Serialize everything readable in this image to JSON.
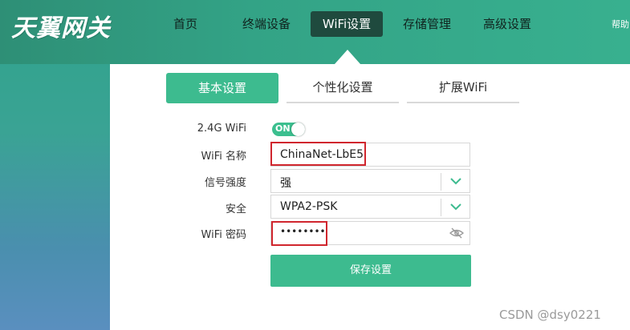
{
  "brand": {
    "logo_text": "天翼网关"
  },
  "nav": {
    "items": [
      {
        "label": "首页"
      },
      {
        "label": "终端设备"
      },
      {
        "label": "WiFi设置",
        "active": true
      },
      {
        "label": "存储管理"
      },
      {
        "label": "高级设置"
      }
    ],
    "help": "帮助"
  },
  "tabs": [
    {
      "label": "基本设置",
      "active": true
    },
    {
      "label": "个性化设置"
    },
    {
      "label": "扩展WiFi"
    }
  ],
  "form": {
    "wifi24_label": "2.4G WiFi",
    "toggle_text": "ON",
    "ssid_label": "WiFi 名称",
    "ssid_value": "ChinaNet-LbE5",
    "signal_label": "信号强度",
    "signal_value": "强",
    "security_label": "安全",
    "security_value": "WPA2-PSK",
    "password_label": "WiFi 密码",
    "password_value": "••••••••",
    "save_label": "保存设置"
  },
  "watermark": "CSDN @dsy0221",
  "colors": {
    "accent": "#3dbb8f",
    "nav_active": "#1f4a3e",
    "highlight": "#d0262e"
  }
}
